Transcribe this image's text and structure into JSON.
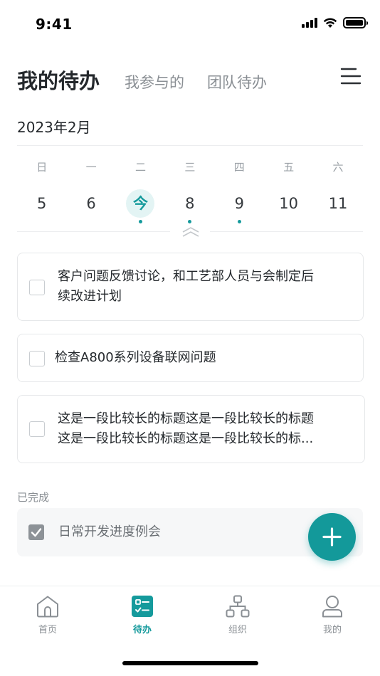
{
  "status_bar": {
    "time": "9:41",
    "battery_level": 1.0
  },
  "header": {
    "title": "我的待办",
    "tabs": [
      "我参与的",
      "团队待办"
    ]
  },
  "month": "2023年2月",
  "calendar": {
    "weekdays": [
      "日",
      "一",
      "二",
      "三",
      "四",
      "五",
      "六"
    ],
    "days": [
      "5",
      "6",
      "今",
      "8",
      "9",
      "10",
      "11"
    ],
    "today_index": 2,
    "dots": [
      false,
      false,
      true,
      true,
      true,
      false,
      false
    ]
  },
  "tasks": [
    {
      "title": "客户问题反馈讨论，和工艺部人员与会制定后续改进计划",
      "line1": "客户问题反馈讨论，和工艺部人员与会制定后",
      "line2": "续改进计划"
    },
    {
      "title": "检查A800系列设备联网问题"
    },
    {
      "title": "这是一段比较长的标题这是一段比较长的标题这是一段比较长的标题这是一段比较长的标...",
      "line1": "这是一段比较长的标题这是一段比较长的标题",
      "line2": "这是一段比较长的标题这是一段比较长的标..."
    }
  ],
  "completed": {
    "label": "已完成",
    "items": [
      {
        "title": "日常开发进度例会",
        "checked": true
      }
    ]
  },
  "fab": {
    "icon": "plus-icon"
  },
  "tabbar": {
    "items": [
      {
        "label": "首页",
        "icon": "home-icon",
        "active": false
      },
      {
        "label": "待办",
        "icon": "todo-icon",
        "active": true
      },
      {
        "label": "组织",
        "icon": "org-icon",
        "active": false
      },
      {
        "label": "我的",
        "icon": "user-icon",
        "active": false
      }
    ]
  },
  "colors": {
    "accent": "#13999a",
    "today_bg": "#e3f4f4",
    "text": "#24282c",
    "muted": "#8a8f94"
  }
}
